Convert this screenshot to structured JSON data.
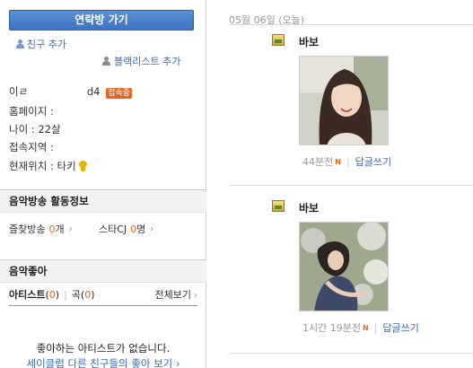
{
  "left": {
    "contact_button": "연락방 가기",
    "add_friend": "친구 추가",
    "add_blacklist": "블랙리스트 추가",
    "profile": {
      "name_label": "이ㄹ",
      "name_value": "d4",
      "online_badge": "접속중",
      "homepage": "홈페이지 :",
      "age": "나이 : 22살",
      "region": "접속지역 :",
      "location": "현재위치 : 타키"
    },
    "music_section": {
      "title": "음악방송 활동정보",
      "fav_label": "즐찾방송",
      "fav_count": "0",
      "fav_unit": "개",
      "star_label": "스타CJ",
      "star_count": "0",
      "star_unit": "명"
    },
    "likes_section": {
      "title": "음악좋아",
      "artist_label": "아티스트",
      "artist_count": "0",
      "song_label": "곡",
      "song_count": "0",
      "view_all": "전체보기",
      "empty_message": "좋아하는 아티스트가 없습니다.",
      "empty_link": "세이클럽 다른 친구들의 좋아 보기 ›"
    }
  },
  "right": {
    "date": "05월 06일 (오늘)",
    "posts": [
      {
        "author": "바보",
        "time": "44분전",
        "new_badge": "N",
        "reply": "답글쓰기"
      },
      {
        "author": "바보",
        "time": "1시간 19분전",
        "new_badge": "N",
        "reply": "답글쓰기"
      }
    ]
  },
  "colors": {
    "accent_blue": "#3d73c0",
    "orange": "#e8661c",
    "link": "#3b6bb0"
  }
}
